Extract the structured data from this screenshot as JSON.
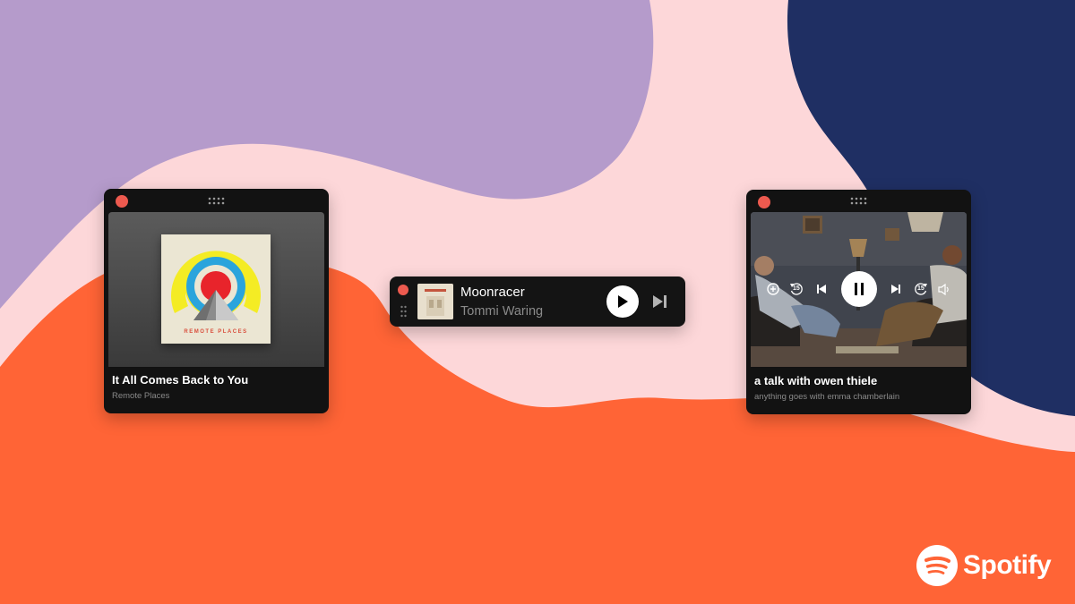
{
  "album_player": {
    "track_title": "It All Comes Back to You",
    "artist": "Remote Places",
    "cover_text": "REMOTE PLACES"
  },
  "compact_player": {
    "track_title": "Moonracer",
    "artist": "Tommi Waring"
  },
  "video_player": {
    "episode_title": "a talk with owen thiele",
    "show_name": "anything goes with emma chamberlain",
    "skip_back_seconds": "15",
    "skip_forward_seconds": "15"
  },
  "brand": {
    "name": "Spotify"
  },
  "colors": {
    "background_pink": "#fdd7d9",
    "lavender": "#b59bcb",
    "navy": "#1f2f63",
    "orange": "#ff6436",
    "player_bg": "#121212",
    "close_red": "#ed5a4f"
  },
  "icons": {
    "close": "close-icon",
    "drag": "drag-handle-icon",
    "play": "play-icon",
    "pause": "pause-icon",
    "next": "skip-next-icon",
    "previous": "skip-previous-icon",
    "add": "add-icon",
    "replay15": "skip-back-15-icon",
    "forward15": "skip-forward-15-icon",
    "volume": "volume-icon",
    "logo": "spotify-logo-icon"
  }
}
